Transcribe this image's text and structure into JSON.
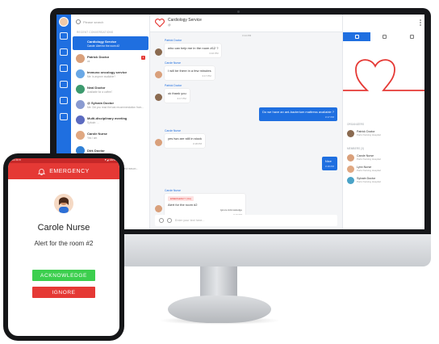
{
  "monitor": {
    "search_placeholder": "Please search",
    "recent_header": "RECENT CONVERSATIONS",
    "conversations": [
      {
        "title": "Cardiology Service",
        "subtitle": "Carole: Alert for the room #2",
        "selected": true
      },
      {
        "title": "Patrick Doctor",
        "subtitle": "ok",
        "selected": false,
        "badge": "1"
      },
      {
        "title": "Immuno oncology service",
        "subtitle": "Me: is anyone available?",
        "selected": false
      },
      {
        "title": "Neal Doctor",
        "subtitle": "Available for a coffee?",
        "selected": false
      },
      {
        "title": "@ Sylvain Doctor",
        "subtitle": "Me: Did you read the last recommendation from...",
        "selected": false
      },
      {
        "title": "Multi-disciplinary meeting",
        "subtitle": "Sylvain: ...",
        "selected": false
      },
      {
        "title": "Carole Nurse",
        "subtitle": "Yes I am",
        "selected": false
      },
      {
        "title": "Dirk Doctor",
        "subtitle": "",
        "selected": false
      },
      {
        "title": "Emily",
        "subtitle": "Me: I will return the following at fast reason...",
        "selected": false
      }
    ],
    "chat": {
      "title": "Cardiology Service",
      "subtitle": "@",
      "top_time": "3:14 PM",
      "messages": [
        {
          "sender": "Patrick Doctor",
          "text": "who can help me in the room #12 ?",
          "time": "3:16 PM",
          "mine": false
        },
        {
          "sender": "Carole Nurse",
          "text": "I will be there in a few minutes",
          "time": "3:17 PM",
          "mine": false
        },
        {
          "sender": "Patrick Doctor",
          "text": "ok thank you",
          "time": "3:17 PM",
          "mine": false
        },
        {
          "sender": "",
          "text": "Do we have an ant-bacterium mattress available ?",
          "time": "3:17 PM",
          "mine": true
        },
        {
          "sender": "Carole Nurse",
          "text": "yes two are still in stock",
          "time": "3:18 PM",
          "mine": false
        },
        {
          "sender": "",
          "text": "Nice",
          "time": "3:18 PM",
          "mine": true
        }
      ],
      "emergency_message": {
        "sender": "Carole Nurse",
        "tag": "EMERGENCY (3m)",
        "text": "Alert for the room #2",
        "actions": "Ignore  Acknowledge",
        "time": "3:19 PM"
      },
      "composer_placeholder": "Enter your text here..."
    },
    "right_panel": {
      "organizers_header": "ORGANIZERS",
      "organizers": [
        {
          "name": "Patrick Doctor",
          "role": "Paris Nursing Hospital"
        }
      ],
      "members_header": "MEMBERS (3)",
      "members": [
        {
          "name": "Carole Nurse",
          "role": "Paris Nursing Hospital"
        },
        {
          "name": "Lynn Nurse",
          "role": "Paris Nursing Hospital"
        },
        {
          "name": "Sylvain Doctor",
          "role": "Paris Nursing Hospital"
        }
      ]
    }
  },
  "phone": {
    "status_left": "12:30 ✉",
    "status_right": "▼◢ 100%",
    "header_title": "EMERGENCY",
    "name": "Carole Nurse",
    "alert": "Alert for the room #2",
    "acknowledge_label": "ACKNOWLEDGE",
    "ignore_label": "IGNORE"
  },
  "colors": {
    "brand_blue": "#1f6fe0",
    "emergency_red": "#e53935",
    "acknowledge_green": "#3ccf4e"
  }
}
